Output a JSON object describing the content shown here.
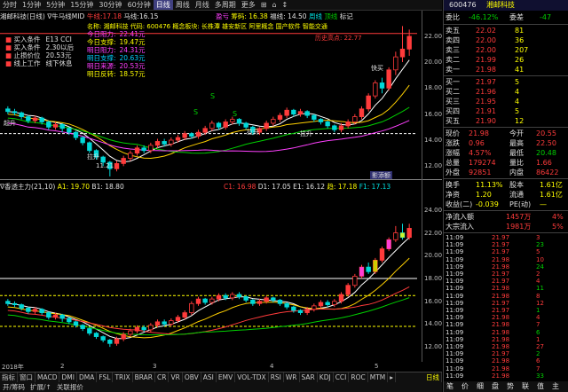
{
  "toolbar": {
    "periods": [
      "分时",
      "1分钟",
      "5分钟",
      "15分钟",
      "30分钟",
      "60分钟",
      "日线",
      "周线",
      "月线",
      "多周期",
      "更多"
    ],
    "selected": "日线",
    "tools": [
      "⊞",
      "⌂",
      "↕"
    ]
  },
  "main_header": {
    "stock": "湘邮科技(日线)",
    "indicator": "∇牛马线MID",
    "legend_a_label": "牛线:",
    "legend_a_value": "17.18",
    "legend_b_label": "马线:",
    "legend_b_value": "16.15",
    "center_a": "盈亏",
    "center_b": "筹码: 16.38",
    "center_c": "福线: 14.50",
    "center_d": "周线",
    "center_e": "顶线",
    "center_f": "标记"
  },
  "signal_box": {
    "rows": [
      {
        "label": "买入条件",
        "value": "E13 CCI"
      },
      {
        "label": "买入条件",
        "value": "2.30以后"
      },
      {
        "label": "止损价位",
        "value": "20.53元"
      },
      {
        "label": "线上工作",
        "value": "线下休息"
      }
    ]
  },
  "target_box": {
    "rows": [
      {
        "label": "今日阻力:",
        "value": "22.41元"
      },
      {
        "label": "今日支撑:",
        "value": "19.47元"
      },
      {
        "label": "明日阻力:",
        "value": "24.31元"
      },
      {
        "label": "明日支撑:",
        "value": "20.63元"
      },
      {
        "label": "明日来源:",
        "value": "20.53元"
      },
      {
        "label": "明日反转:",
        "value": "18.57元"
      }
    ]
  },
  "info_line": "名称: 湘邮科技 代码: 600476 概念板块: 长株潭 雄安新区 阿里概念 国产软件 智能交通",
  "annotations": {
    "peak": "历史高点: 22.77",
    "buy": "快买",
    "up1": "拉升",
    "up2": "拉升",
    "up3": "拉升",
    "start": "起升",
    "low": "11.21",
    "s1": "S",
    "s2": "S",
    "s3": "S",
    "bar_label": "影添额"
  },
  "sub_header": {
    "name": "∇香透主力(21,10)",
    "a1": "A1: 19.70",
    "b1": "B1: 18.80",
    "c1": "C1: 16.98",
    "d1": "D1: 17.05",
    "e1": "E1: 16.12",
    "trend": "趋: 17.18",
    "f1": "F1: 17.13"
  },
  "yaxis_main": [
    "22.00",
    "20.00",
    "18.00",
    "16.00",
    "14.00",
    "12.00"
  ],
  "yaxis_sub": [
    "24.00",
    "22.00",
    "20.00",
    "18.00",
    "16.00",
    "14.00",
    "12.00"
  ],
  "tabs": [
    "指标",
    "窗口",
    "MACD",
    "DMI",
    "DMA",
    "FSL",
    "TRIX",
    "BRAR",
    "CR",
    "VR",
    "OBV",
    "ASI",
    "EMV",
    "VOL-TDX",
    "RSI",
    "WR",
    "SAR",
    "KDJ",
    "CCI",
    "ROC",
    "MTM",
    "▸"
  ],
  "selected_tab": "日线",
  "bottom": [
    "开/筹码",
    "扩展/↑",
    "关联报价"
  ],
  "date_axis": [
    "2018年",
    "2",
    "3",
    "4",
    "5"
  ],
  "quote": {
    "code": "600476",
    "name": "湘邮科技",
    "weibi_label": "委比",
    "weibi_value": "-46.12%",
    "weicha_label": "委差",
    "weicha_value": "-47",
    "sells": [
      {
        "label": "卖五",
        "price": "22.02",
        "vol": "81"
      },
      {
        "label": "卖四",
        "price": "22.00",
        "vol": "36"
      },
      {
        "label": "卖三",
        "price": "22.00",
        "vol": "207"
      },
      {
        "label": "卖二",
        "price": "21.99",
        "vol": "26"
      },
      {
        "label": "卖一",
        "price": "21.98",
        "vol": "41"
      }
    ],
    "buys": [
      {
        "label": "买一",
        "price": "21.97",
        "vol": "5"
      },
      {
        "label": "买二",
        "price": "21.96",
        "vol": "4"
      },
      {
        "label": "买三",
        "price": "21.95",
        "vol": "4"
      },
      {
        "label": "买四",
        "price": "21.91",
        "vol": "5"
      },
      {
        "label": "买五",
        "price": "21.90",
        "vol": "12"
      }
    ],
    "stats": [
      {
        "l1": "现价",
        "v1": "21.98",
        "l2": "今开",
        "v2": "20.55"
      },
      {
        "l1": "涨跌",
        "v1": "0.96",
        "l2": "最高",
        "v2": "22.50"
      },
      {
        "l1": "涨幅",
        "v1": "4.57%",
        "l2": "最低",
        "v2": "20.48"
      },
      {
        "l1": "总量",
        "v1": "179274",
        "l2": "量比",
        "v2": "1.66"
      },
      {
        "l1": "外盘",
        "v1": "92851",
        "l2": "内盘",
        "v2": "86422"
      }
    ],
    "stats2": [
      {
        "l1": "换手",
        "v1": "11.13%",
        "l2": "股本",
        "v2": "1.61亿"
      },
      {
        "l1": "净资",
        "v1": "1.20",
        "l2": "流通",
        "v2": "1.61亿"
      },
      {
        "l1": "收益(二)",
        "v1": "-0.039",
        "l2": "PE(动)",
        "v2": "—"
      }
    ],
    "flow": [
      {
        "label": "净流入额",
        "value": "1457万",
        "pct": "4%"
      },
      {
        "label": "大宗流入",
        "value": "1981万",
        "pct": "5%"
      }
    ],
    "ticks": [
      {
        "t": "11:09",
        "p": "21.97",
        "v": "3"
      },
      {
        "t": "11:09",
        "p": "21.97",
        "v": "23"
      },
      {
        "t": "11:09",
        "p": "21.97",
        "v": "5"
      },
      {
        "t": "11:09",
        "p": "21.98",
        "v": "10"
      },
      {
        "t": "11:09",
        "p": "21.98",
        "v": "24"
      },
      {
        "t": "11:09",
        "p": "21.97",
        "v": "2"
      },
      {
        "t": "11:09",
        "p": "21.97",
        "v": "4"
      },
      {
        "t": "11:09",
        "p": "21.98",
        "v": "11"
      },
      {
        "t": "11:09",
        "p": "21.98",
        "v": "8"
      },
      {
        "t": "11:09",
        "p": "21.97",
        "v": "12"
      },
      {
        "t": "11:09",
        "p": "21.97",
        "v": "1"
      },
      {
        "t": "11:09",
        "p": "21.98",
        "v": "4"
      },
      {
        "t": "11:09",
        "p": "21.98",
        "v": "7"
      },
      {
        "t": "11:09",
        "p": "21.98",
        "v": "6"
      },
      {
        "t": "11:09",
        "p": "21.98",
        "v": "1"
      },
      {
        "t": "11:09",
        "p": "21.98",
        "v": "27"
      },
      {
        "t": "11:09",
        "p": "21.97",
        "v": "2"
      },
      {
        "t": "11:09",
        "p": "21.98",
        "v": "6"
      },
      {
        "t": "11:09",
        "p": "21.98",
        "v": "7"
      },
      {
        "t": "11:09",
        "p": "21.98",
        "v": "33"
      }
    ],
    "tabs": [
      "笔",
      "价",
      "细",
      "盘",
      "势",
      "联",
      "值",
      "主"
    ]
  },
  "chart_data": [
    {
      "type": "candlestick",
      "title": "",
      "ylim": [
        11,
        23
      ],
      "candles": [
        [
          16.4,
          16.2,
          16.6,
          16.0
        ],
        [
          16.2,
          16.1,
          16.4,
          15.9
        ],
        [
          16.1,
          15.8,
          16.2,
          15.6
        ],
        [
          15.8,
          15.5,
          15.9,
          15.3
        ],
        [
          15.5,
          15.7,
          15.9,
          15.3
        ],
        [
          15.7,
          15.4,
          15.8,
          15.2
        ],
        [
          15.4,
          15.0,
          15.5,
          14.8
        ],
        [
          15.0,
          15.2,
          15.4,
          14.8
        ],
        [
          15.2,
          14.9,
          15.3,
          14.6
        ],
        [
          14.9,
          14.6,
          15.0,
          14.4
        ],
        [
          14.6,
          14.2,
          14.7,
          14.0
        ],
        [
          14.2,
          13.8,
          14.3,
          13.6
        ],
        [
          13.8,
          13.2,
          13.9,
          13.0
        ],
        [
          13.2,
          12.7,
          13.3,
          12.5
        ],
        [
          12.7,
          12.3,
          12.8,
          12.0
        ],
        [
          12.3,
          11.8,
          12.4,
          11.21
        ],
        [
          11.8,
          12.2,
          12.4,
          11.6
        ],
        [
          12.2,
          12.6,
          12.8,
          12.0
        ],
        [
          12.6,
          13.0,
          13.2,
          12.4
        ],
        [
          13.0,
          13.4,
          13.6,
          12.8
        ],
        [
          13.4,
          13.2,
          13.6,
          13.0
        ],
        [
          13.2,
          13.6,
          13.8,
          13.0
        ],
        [
          13.6,
          13.9,
          14.1,
          13.4
        ],
        [
          13.9,
          13.7,
          14.1,
          13.5
        ],
        [
          13.7,
          14.0,
          14.2,
          13.5
        ],
        [
          14.0,
          14.2,
          14.4,
          13.8
        ],
        [
          14.2,
          14.5,
          14.7,
          14.0
        ],
        [
          14.5,
          14.3,
          14.6,
          14.1
        ],
        [
          14.3,
          14.6,
          14.8,
          14.1
        ],
        [
          14.6,
          14.9,
          15.1,
          14.4
        ],
        [
          14.9,
          15.3,
          15.5,
          14.7
        ],
        [
          15.3,
          15.0,
          15.4,
          14.8
        ],
        [
          15.0,
          15.4,
          15.6,
          14.8
        ],
        [
          15.4,
          15.6,
          15.8,
          15.2
        ],
        [
          15.6,
          15.3,
          15.7,
          15.1
        ],
        [
          15.3,
          15.0,
          15.4,
          14.8
        ],
        [
          15.0,
          14.6,
          15.1,
          14.4
        ],
        [
          14.6,
          14.9,
          15.0,
          14.4
        ],
        [
          14.9,
          15.3,
          15.5,
          14.7
        ],
        [
          15.3,
          15.6,
          15.8,
          15.1
        ],
        [
          15.6,
          15.9,
          16.1,
          15.4
        ],
        [
          15.9,
          16.3,
          16.5,
          15.7
        ],
        [
          16.3,
          16.0,
          16.4,
          15.8
        ],
        [
          16.0,
          16.2,
          16.4,
          15.8
        ],
        [
          16.2,
          15.9,
          16.3,
          15.7
        ],
        [
          15.9,
          15.6,
          16.0,
          15.4
        ],
        [
          15.6,
          15.4,
          15.7,
          15.2
        ],
        [
          15.4,
          15.1,
          15.5,
          14.9
        ],
        [
          15.1,
          14.8,
          15.2,
          14.6
        ],
        [
          14.8,
          15.1,
          15.3,
          14.6
        ],
        [
          15.1,
          15.4,
          15.6,
          14.9
        ],
        [
          15.4,
          15.8,
          16.0,
          15.2
        ],
        [
          15.8,
          16.4,
          16.6,
          15.6
        ],
        [
          16.4,
          17.4,
          17.6,
          16.2
        ],
        [
          17.4,
          18.4,
          18.6,
          17.2
        ],
        [
          18.4,
          18.0,
          18.8,
          17.6
        ],
        [
          18.0,
          19.4,
          19.6,
          17.8
        ],
        [
          19.4,
          20.4,
          20.8,
          19.0
        ],
        [
          20.4,
          21.0,
          22.77,
          20.0
        ],
        [
          21.0,
          21.98,
          22.5,
          20.48
        ]
      ]
    },
    {
      "type": "candlestick",
      "title": "",
      "ylim": [
        11,
        25
      ],
      "candles": [
        [
          16.0,
          15.8,
          16.2,
          15.6
        ],
        [
          15.8,
          15.7,
          16.0,
          15.5
        ],
        [
          15.7,
          15.4,
          15.8,
          15.2
        ],
        [
          15.4,
          15.1,
          15.5,
          14.9
        ],
        [
          15.1,
          15.3,
          15.5,
          14.9
        ],
        [
          15.3,
          15.0,
          15.4,
          14.8
        ],
        [
          15.0,
          14.6,
          15.1,
          14.4
        ],
        [
          14.6,
          14.8,
          15.0,
          14.4
        ],
        [
          14.8,
          14.5,
          14.9,
          14.2
        ],
        [
          14.5,
          14.2,
          14.6,
          14.0
        ],
        [
          14.2,
          13.9,
          14.3,
          13.7
        ],
        [
          13.9,
          13.6,
          14.0,
          13.4
        ],
        [
          13.6,
          13.2,
          13.7,
          13.0
        ],
        [
          13.2,
          12.9,
          13.3,
          12.7
        ],
        [
          12.9,
          12.6,
          13.0,
          12.4
        ],
        [
          12.6,
          12.3,
          12.7,
          12.0
        ],
        [
          12.3,
          12.7,
          12.9,
          12.1
        ],
        [
          12.7,
          13.1,
          13.3,
          12.5
        ],
        [
          13.1,
          13.4,
          13.6,
          12.9
        ],
        [
          13.4,
          13.7,
          13.9,
          13.2
        ],
        [
          13.7,
          13.5,
          13.9,
          13.3
        ],
        [
          13.5,
          13.9,
          14.1,
          13.3
        ],
        [
          13.9,
          14.2,
          14.4,
          13.7
        ],
        [
          14.2,
          14.0,
          14.4,
          13.8
        ],
        [
          14.0,
          14.3,
          14.5,
          13.8
        ],
        [
          14.3,
          14.6,
          14.8,
          14.1
        ],
        [
          14.6,
          15.0,
          15.2,
          14.4
        ],
        [
          15.0,
          15.8,
          16.0,
          14.8
        ],
        [
          15.8,
          16.2,
          16.4,
          15.6
        ],
        [
          16.2,
          15.9,
          16.3,
          15.7
        ],
        [
          15.9,
          16.2,
          16.4,
          15.7
        ],
        [
          16.2,
          16.5,
          16.7,
          16.0
        ],
        [
          16.5,
          16.3,
          16.7,
          16.1
        ],
        [
          16.3,
          16.6,
          16.8,
          16.1
        ],
        [
          16.6,
          16.4,
          16.8,
          16.2
        ],
        [
          16.4,
          16.1,
          16.5,
          15.9
        ],
        [
          16.1,
          15.8,
          16.2,
          15.6
        ],
        [
          15.8,
          16.0,
          16.2,
          15.6
        ],
        [
          16.0,
          16.3,
          16.5,
          15.8
        ],
        [
          16.3,
          16.1,
          16.4,
          15.9
        ],
        [
          16.1,
          15.8,
          16.2,
          15.6
        ],
        [
          15.8,
          15.5,
          15.9,
          15.3
        ],
        [
          15.5,
          15.2,
          15.6,
          15.0
        ],
        [
          15.2,
          15.0,
          15.3,
          14.8
        ],
        [
          15.0,
          15.3,
          15.5,
          14.8
        ],
        [
          15.3,
          15.6,
          15.8,
          15.1
        ],
        [
          15.6,
          15.9,
          16.1,
          15.4
        ],
        [
          15.9,
          15.7,
          16.1,
          15.5
        ],
        [
          15.7,
          16.0,
          16.2,
          15.5
        ],
        [
          16.0,
          16.6,
          16.8,
          15.8
        ],
        [
          16.6,
          17.4,
          17.6,
          16.4
        ],
        [
          17.4,
          18.2,
          18.4,
          17.2
        ],
        [
          18.2,
          19.0,
          19.2,
          18.0
        ],
        [
          19.0,
          18.6,
          19.4,
          18.4
        ],
        [
          18.6,
          19.6,
          19.8,
          18.4
        ],
        [
          19.6,
          20.6,
          20.8,
          19.4
        ],
        [
          20.6,
          21.4,
          21.6,
          20.4
        ],
        [
          21.4,
          22.0,
          22.6,
          21.2
        ],
        [
          22.0,
          21.6,
          22.8,
          21.4
        ],
        [
          21.6,
          22.4,
          22.8,
          21.4
        ]
      ]
    }
  ]
}
